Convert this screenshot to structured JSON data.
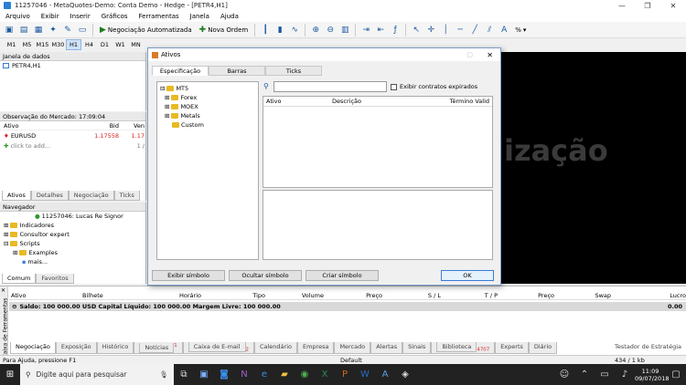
{
  "window": {
    "title": "11257046 - MetaQuotes-Demo: Conta Demo - Hedge - [PETR4,H1]",
    "min": "—",
    "restore": "❐",
    "close": "✕"
  },
  "menu": [
    "Arquivo",
    "Exibir",
    "Inserir",
    "Gráficos",
    "Ferramentas",
    "Janela",
    "Ajuda"
  ],
  "toolbar": {
    "algo": "Negociação Automatizada",
    "new_order": "Nova Ordem",
    "pct": "%"
  },
  "timeframes": [
    "M1",
    "M5",
    "M15",
    "M30",
    "H1",
    "H4",
    "D1",
    "W1",
    "MN"
  ],
  "data_window": {
    "title": "Janela de dados",
    "symbol": "PETR4,H1"
  },
  "market_watch": {
    "title": "Observação do Mercado: 17:09:04",
    "col_symbol": "Ativo",
    "col_bid": "Bid",
    "col_ask": "Ven",
    "row_symbol": "EURUSD",
    "row_bid": "1.17558",
    "row_ask": "1.17",
    "add_row": "click to add...",
    "add_count": "1 /",
    "tabs": [
      "Ativos",
      "Detalhes",
      "Negociação",
      "Ticks"
    ]
  },
  "navigator": {
    "title": "Navegador",
    "account": "11257046: Lucas Re Signor",
    "items": [
      "Indicadores",
      "Consultor expert",
      "Scripts",
      "Examples",
      "mais..."
    ],
    "tabs": [
      "Comum",
      "Favoritos"
    ]
  },
  "chart": {
    "watermark": "lização"
  },
  "dialog": {
    "title": "Ativos",
    "tabs": [
      "Especificação",
      "Barras",
      "Ticks"
    ],
    "tree_root": "MT5",
    "tree": [
      "Forex",
      "MOEX",
      "Metals",
      "Custom"
    ],
    "search_value": "",
    "checkbox": "Exibir contratos expirados",
    "cols": [
      "Ativo",
      "Descrição",
      "Término Valid"
    ],
    "buttons": [
      "Exibir símbolo",
      "Ocultar símbolo",
      "Criar símbolo"
    ],
    "ok": "OK"
  },
  "terminal": {
    "headers": [
      "Ativo",
      "Bilhete",
      "Horário",
      "Tipo",
      "Volume",
      "Preço",
      "S / L",
      "T / P",
      "Preço",
      "Swap",
      "Lucro"
    ],
    "balance": "Saldo: 100 000.00 USD  Capital Líquido: 100 000.00  Margem Livre: 100 000.00",
    "profit": "0.00",
    "side_label": "Caixa de Ferramentas",
    "tabs": [
      "Negociação",
      "Exposição",
      "Histórico",
      "Notícias",
      "Caixa de E-mail",
      "Calendário",
      "Empresa",
      "Mercado",
      "Alertas",
      "Sinais",
      "Biblioteca",
      "Experts",
      "Diário"
    ],
    "news_badge": "1",
    "mail_badge": "2",
    "lib_badge": "4707",
    "tester": "Testador de Estratégia"
  },
  "statusbar": {
    "help": "Para Ajuda, pressione F1",
    "profile": "Default",
    "traffic": "434 / 1 kb"
  },
  "taskbar": {
    "search": "Digite aqui para pesquisar",
    "time": "11:09",
    "date": "09/07/2018"
  }
}
